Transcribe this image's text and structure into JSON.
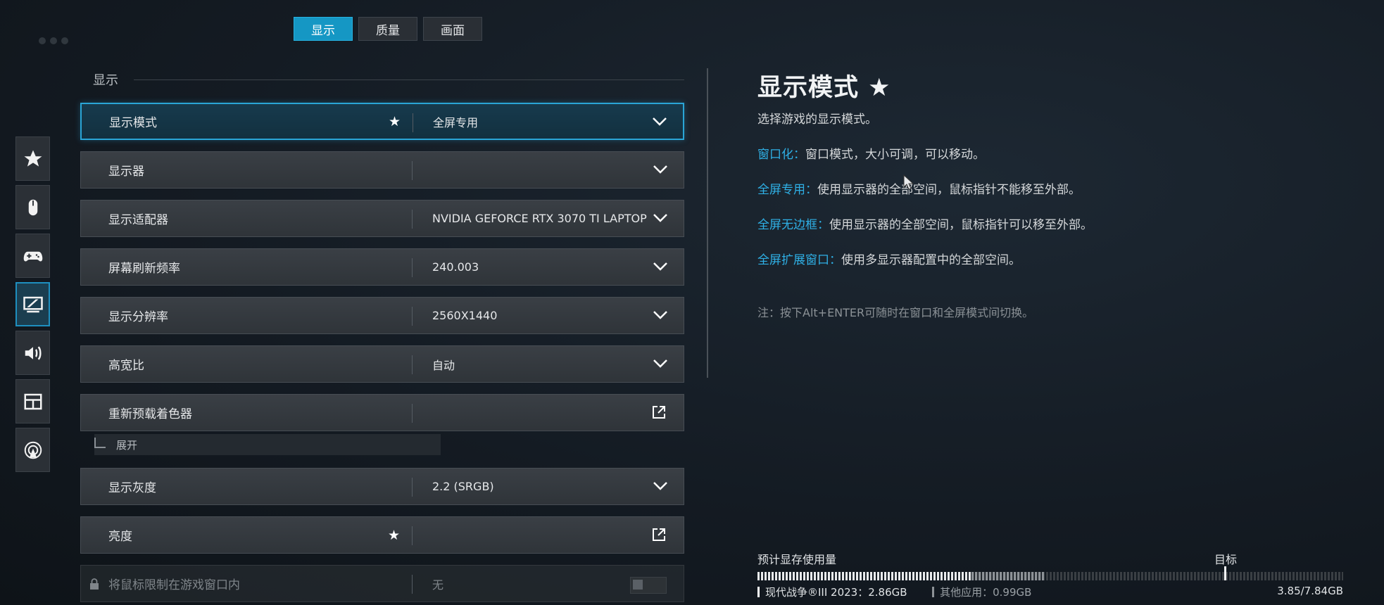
{
  "tabs": [
    "显示",
    "质量",
    "画面"
  ],
  "active_tab": 0,
  "sidebar": {
    "items": [
      {
        "icon": "star-icon"
      },
      {
        "icon": "mouse-icon"
      },
      {
        "icon": "gamepad-icon"
      },
      {
        "icon": "monitor-icon",
        "active": true
      },
      {
        "icon": "speaker-icon"
      },
      {
        "icon": "interface-icon"
      },
      {
        "icon": "network-icon"
      }
    ]
  },
  "section": {
    "title": "显示"
  },
  "settings": [
    {
      "label": "显示模式",
      "value": "全屏专用",
      "star": "★",
      "control": "dropdown",
      "active": true
    },
    {
      "label": "显示器",
      "value": "",
      "control": "dropdown"
    },
    {
      "label": "显示适配器",
      "value": "NVIDIA GEFORCE RTX 3070 TI LAPTOP GPU",
      "control": "dropdown"
    },
    {
      "label": "屏幕刷新频率",
      "value": "240.003",
      "control": "dropdown"
    },
    {
      "label": "显示分辨率",
      "value": "2560X1440",
      "control": "dropdown"
    },
    {
      "label": "高宽比",
      "value": "自动",
      "control": "dropdown"
    },
    {
      "label": "重新预载着色器",
      "value": "",
      "control": "external"
    },
    {
      "label": "显示灰度",
      "value": "2.2 (SRGB)",
      "control": "dropdown"
    },
    {
      "label": "亮度",
      "value": "",
      "star": "★",
      "control": "external"
    },
    {
      "label": "将鼠标限制在游戏窗口内",
      "value": "无",
      "control": "toggle",
      "locked": true
    }
  ],
  "sub_item": {
    "label": "展开"
  },
  "description": {
    "title": "显示模式 ★",
    "subtitle": "选择游戏的显示模式。",
    "items": [
      {
        "term": "窗口化：",
        "text": "窗口模式，大小可调，可以移动。"
      },
      {
        "term": "全屏专用：",
        "text": "使用显示器的全部空间，鼠标指针不能移至外部。"
      },
      {
        "term": "全屏无边框：",
        "text": "使用显示器的全部空间，鼠标指针可以移至外部。"
      },
      {
        "term": "全屏扩展窗口：",
        "text": "使用多显示器配置中的全部空间。"
      }
    ],
    "note": "注：按下Alt+ENTER可随时在窗口和全屏模式间切换。"
  },
  "vram": {
    "title": "预计显存使用量",
    "target_label": "目标",
    "game_label": "现代战争®III 2023：2.86GB",
    "other_label": "其他应用：0.99GB",
    "total": "3.85/7.84GB",
    "game_gb": 2.86,
    "other_gb": 0.99,
    "capacity_gb": 7.84
  }
}
